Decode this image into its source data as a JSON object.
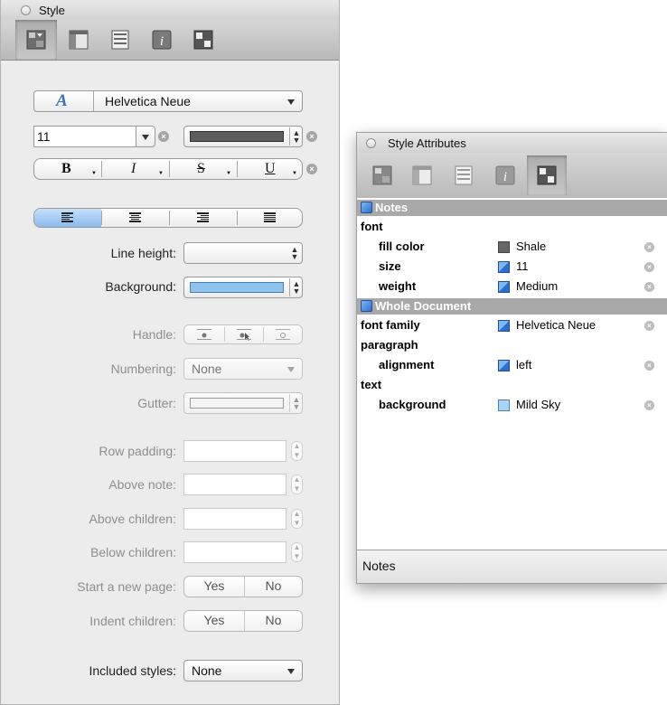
{
  "style_panel": {
    "title": "Style",
    "toolbar": {
      "tabs": [
        {
          "name": "style-tab",
          "selected": true
        },
        {
          "name": "layout-tab",
          "selected": false
        },
        {
          "name": "document-tab",
          "selected": false
        },
        {
          "name": "info-tab",
          "selected": false
        },
        {
          "name": "attributes-tab",
          "selected": false
        }
      ]
    },
    "font": {
      "family": "Helvetica Neue",
      "size": "11",
      "color": "#5d5d5d"
    },
    "text_style_buttons": [
      "B",
      "I",
      "S",
      "U"
    ],
    "alignment": {
      "options": [
        "left",
        "center",
        "right",
        "justified"
      ],
      "selected": "left"
    },
    "line_height": {
      "label": "Line height:",
      "value": ""
    },
    "background": {
      "label": "Background:",
      "color": "#8fc4ee"
    },
    "handle": {
      "label": "Handle:"
    },
    "numbering": {
      "label": "Numbering:",
      "value": "None"
    },
    "gutter": {
      "label": "Gutter:"
    },
    "row_padding": {
      "label": "Row padding:",
      "value": ""
    },
    "above_note": {
      "label": "Above note:",
      "value": ""
    },
    "above_children": {
      "label": "Above children:",
      "value": ""
    },
    "below_children": {
      "label": "Below children:",
      "value": ""
    },
    "start_new_page": {
      "label": "Start a new page:",
      "yes": "Yes",
      "no": "No"
    },
    "indent_children": {
      "label": "Indent children:",
      "yes": "Yes",
      "no": "No"
    },
    "included_styles": {
      "label": "Included styles:",
      "value": "None"
    }
  },
  "attributes_panel": {
    "title": "Style Attributes",
    "toolbar": {
      "tabs": [
        {
          "name": "style-tab",
          "selected": false
        },
        {
          "name": "layout-tab",
          "selected": false
        },
        {
          "name": "document-tab",
          "selected": false
        },
        {
          "name": "info-tab",
          "selected": false
        },
        {
          "name": "attributes-tab",
          "selected": true
        }
      ]
    },
    "groups": [
      {
        "name": "Notes",
        "rows": [
          {
            "key": "font",
            "indent": 0,
            "value": "",
            "swatch": null
          },
          {
            "key": "fill color",
            "indent": 1,
            "value": "Shale",
            "swatch": "#666666"
          },
          {
            "key": "size",
            "indent": 1,
            "value": "11",
            "swatch": "style"
          },
          {
            "key": "weight",
            "indent": 1,
            "value": "Medium",
            "swatch": "style"
          }
        ]
      },
      {
        "name": "Whole Document",
        "rows": [
          {
            "key": "font family",
            "indent": 0,
            "value": "Helvetica Neue",
            "swatch": "style"
          },
          {
            "key": "paragraph",
            "indent": 0,
            "value": "",
            "swatch": null
          },
          {
            "key": "alignment",
            "indent": 1,
            "value": "left",
            "swatch": "style"
          },
          {
            "key": "text",
            "indent": 0,
            "value": "",
            "swatch": null
          },
          {
            "key": "background",
            "indent": 1,
            "value": "Mild Sky",
            "swatch": "#a9d4f7"
          }
        ]
      }
    ],
    "footer": "Notes"
  }
}
